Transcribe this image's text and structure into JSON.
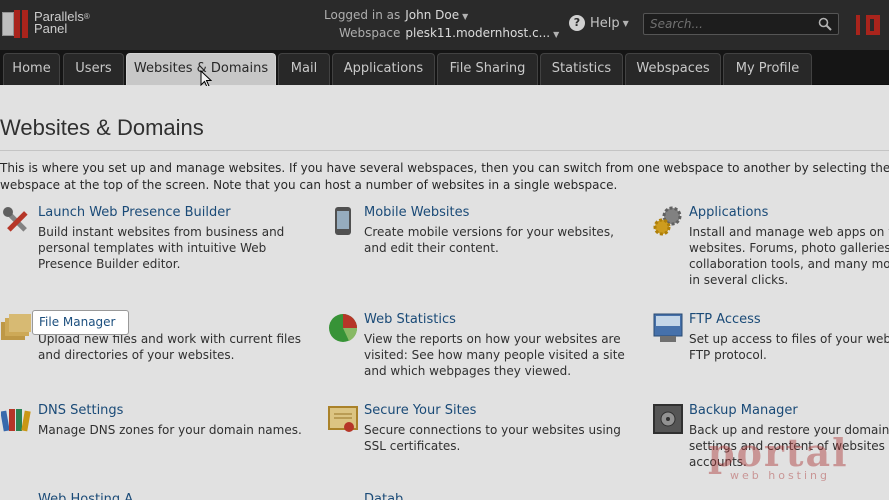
{
  "brand": {
    "line1": "Parallels",
    "reg": "®",
    "line2": "Panel"
  },
  "header": {
    "logged_in_label": "Logged in as",
    "user": "John Doe",
    "webspace_label": "Webspace",
    "webspace": "plesk11.modernhost.c...",
    "help": "Help",
    "search_placeholder": "Search..."
  },
  "tabs": [
    {
      "label": "Home"
    },
    {
      "label": "Users"
    },
    {
      "label": "Websites & Domains",
      "active": true
    },
    {
      "label": "Mail"
    },
    {
      "label": "Applications"
    },
    {
      "label": "File Sharing"
    },
    {
      "label": "Statistics"
    },
    {
      "label": "Webspaces"
    },
    {
      "label": "My Profile"
    }
  ],
  "page": {
    "title": "Websites & Domains",
    "intro_line1": "This is where you set up and manage websites. If you have several webspaces, then you can switch from one webspace to another by selecting the requ",
    "intro_line2": "webspace at the top of the screen. Note that you can host a number of websites in a single webspace."
  },
  "features": [
    {
      "title": "Launch Web Presence Builder",
      "icon": "tools-icon",
      "desc": [
        "Build instant websites from business and",
        "personal templates with intuitive Web",
        "Presence Builder editor."
      ]
    },
    {
      "title": "Mobile Websites",
      "icon": "mobile-phone-icon",
      "desc": [
        "Create mobile versions for your websites,",
        "and edit their content."
      ]
    },
    {
      "title": "Applications",
      "icon": "gears-icon",
      "desc": [
        "Install and manage web apps on yo",
        "websites. Forums, photo galleries",
        "collaboration tools, and many mor",
        "in several clicks."
      ]
    },
    {
      "title": "File Manager",
      "icon": "folders-icon",
      "desc": [
        "Upload new files and work with current files",
        "and directories of your websites."
      ]
    },
    {
      "title": "Web Statistics",
      "icon": "pie-chart-icon",
      "desc": [
        "View the reports on how your websites are",
        "visited: See how many people visited a site",
        "and which webpages they viewed."
      ]
    },
    {
      "title": "FTP Access",
      "icon": "ftp-icon",
      "desc": [
        "Set up access to files of your webs",
        "FTP protocol."
      ]
    },
    {
      "title": "DNS Settings",
      "icon": "dns-books-icon",
      "desc": [
        "Manage DNS zones for your domain names."
      ]
    },
    {
      "title": "Secure Your Sites",
      "icon": "certificate-icon",
      "desc": [
        "Secure connections to your websites using",
        "SSL certificates."
      ]
    },
    {
      "title": "Backup Manager",
      "icon": "safe-icon",
      "desc": [
        "Back up and restore your domains",
        "settings and content of websites a",
        "accounts."
      ]
    },
    {
      "title": "Web Hosting A...",
      "icon": "hosting-icon",
      "desc": []
    },
    {
      "title": "Datab...",
      "icon": "database-icon",
      "desc": []
    }
  ],
  "watermark": {
    "text": "portal",
    "sub": "web hosting"
  }
}
